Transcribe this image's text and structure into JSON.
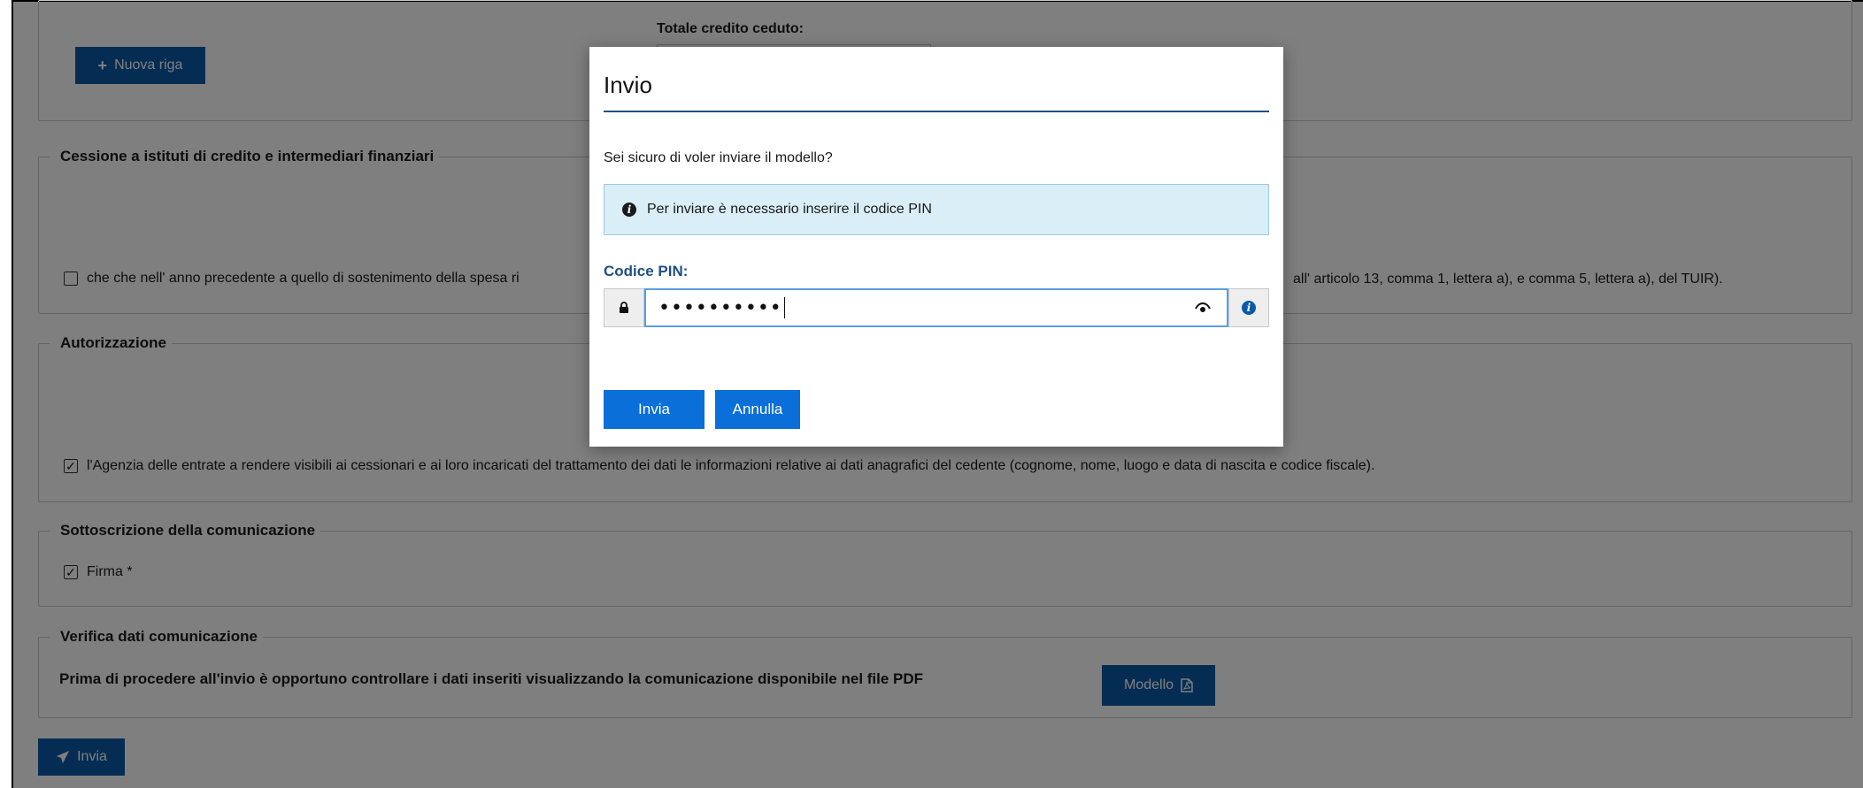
{
  "form": {
    "totale_label": "Totale credito ceduto:",
    "nuova_riga_label": "Nuova riga",
    "cessione": {
      "legend": "Cessione a istituti di credito e intermediari finanziari",
      "checkbox_text_left": "che che nell' anno precedente a quello di sostenimento della spesa ri",
      "checkbox_text_right": "all' articolo 13, comma 1, lettera a), e comma 5, lettera a), del TUIR).",
      "checked": false
    },
    "autorizzazione": {
      "legend": "Autorizzazione",
      "checkbox_text": "l'Agenzia delle entrate a rendere visibili ai cessionari e ai loro incaricati del trattamento dei dati le informazioni relative ai dati anagrafici del cedente (cognome, nome, luogo e data di nascita e codice fiscale).",
      "checked": true
    },
    "sottoscrizione": {
      "legend": "Sottoscrizione della comunicazione",
      "firma_label": "Firma *",
      "checked": true
    },
    "verifica": {
      "legend": "Verifica dati comunicazione",
      "text": "Prima di procedere all'invio è opportuno controllare i dati inseriti visualizzando la comunicazione disponibile nel file PDF",
      "modello_label": "Modello"
    },
    "invia_label": "Invia"
  },
  "modal": {
    "title": "Invio",
    "question": "Sei sicuro di voler inviare il modello?",
    "info_text": "Per inviare è necessario inserire il codice PIN",
    "pin_label": "Codice PIN:",
    "pin_value": "••••••••••",
    "invia_label": "Invia",
    "annulla_label": "Annulla"
  },
  "colors": {
    "primary": "#0a5aa8",
    "modal_button": "#0a6fd8",
    "heading_blue": "#1f4f86",
    "info_bg": "#d9eef6"
  }
}
